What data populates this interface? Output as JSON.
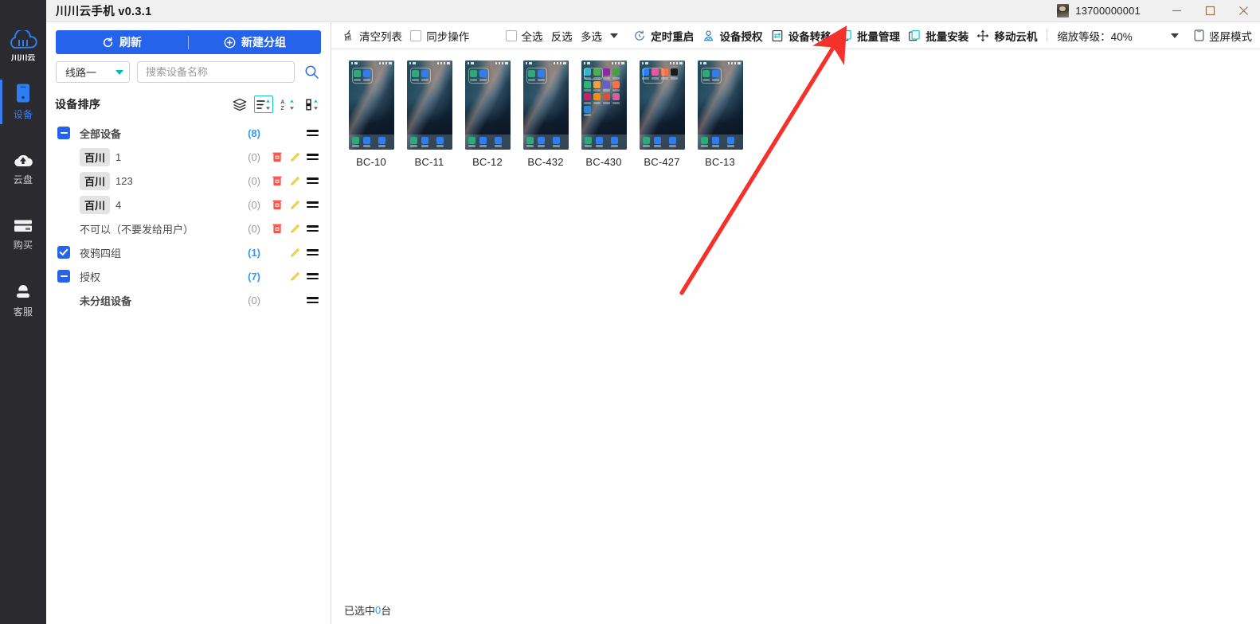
{
  "window": {
    "title": "川川云手机 v0.3.1",
    "account": "13700000001",
    "minimize_label": "—",
    "maximize_label": "□",
    "close_label": "✕"
  },
  "rail": {
    "logo_text": "川川云",
    "items": [
      {
        "label": "设备",
        "icon": "phone-icon",
        "active": true
      },
      {
        "label": "云盘",
        "icon": "cloud-upload-icon",
        "active": false
      },
      {
        "label": "购买",
        "icon": "credit-card-icon",
        "active": false
      },
      {
        "label": "客服",
        "icon": "headset-person-icon",
        "active": false
      }
    ]
  },
  "groups_panel": {
    "refresh_label": "刷新",
    "new_group_label": "新建分组",
    "line_select": "线路一",
    "search_placeholder": "搜索设备名称",
    "search_value": "",
    "sort_title": "设备排序",
    "sort_icons": [
      {
        "name": "layers-icon",
        "active": false
      },
      {
        "name": "list-sort-icon",
        "active": true
      },
      {
        "name": "alpha-sort-icon",
        "active": false
      },
      {
        "name": "column-sort-icon",
        "active": false
      }
    ],
    "rows": [
      {
        "check": "partial",
        "tag": "",
        "name": "全部设备",
        "count": "(8)",
        "count_hl": true,
        "bold": true,
        "indent": false,
        "delete": false,
        "edit": false
      },
      {
        "check": "none",
        "tag": "百川",
        "name": "1",
        "count": "(0)",
        "count_hl": false,
        "bold": false,
        "indent": true,
        "delete": true,
        "edit": true
      },
      {
        "check": "none",
        "tag": "百川",
        "name": "123",
        "count": "(0)",
        "count_hl": false,
        "bold": false,
        "indent": true,
        "delete": true,
        "edit": true
      },
      {
        "check": "none",
        "tag": "百川",
        "name": "4",
        "count": "(0)",
        "count_hl": false,
        "bold": false,
        "indent": true,
        "delete": true,
        "edit": true
      },
      {
        "check": "none",
        "tag": "",
        "name": "不可以（不要发给用户）",
        "count": "(0)",
        "count_hl": false,
        "bold": false,
        "indent": true,
        "delete": true,
        "edit": true
      },
      {
        "check": "checked",
        "tag": "",
        "name": "夜鸦四组",
        "count": "(1)",
        "count_hl": true,
        "bold": false,
        "indent": false,
        "delete": false,
        "edit": true
      },
      {
        "check": "partial",
        "tag": "",
        "name": "授权",
        "count": "(7)",
        "count_hl": true,
        "bold": false,
        "indent": false,
        "delete": false,
        "edit": true
      },
      {
        "check": "none",
        "tag": "",
        "name": "未分组设备",
        "count": "(0)",
        "count_hl": false,
        "bold": true,
        "indent": true,
        "delete": false,
        "edit": false
      }
    ]
  },
  "toolbar": {
    "clear_list": "清空列表",
    "sync_op": "同步操作",
    "select_all": "全选",
    "invert_select": "反选",
    "multi_select": "多选",
    "timed_restart": "定时重启",
    "device_auth": "设备授权",
    "device_transfer": "设备转移",
    "batch_manage": "批量管理",
    "batch_install": "批量安装",
    "move_cloud": "移动云机",
    "zoom_label": "缩放等级：40%",
    "portrait_mode": "竖屏模式"
  },
  "devices": [
    {
      "name": "BC-10",
      "layout": "sparse"
    },
    {
      "name": "BC-11",
      "layout": "sparse"
    },
    {
      "name": "BC-12",
      "layout": "sparse"
    },
    {
      "name": "BC-432",
      "layout": "sparse"
    },
    {
      "name": "BC-430",
      "layout": "full"
    },
    {
      "name": "BC-427",
      "layout": "row4"
    },
    {
      "name": "BC-13",
      "layout": "sparse"
    }
  ],
  "status": {
    "prefix": "已选中",
    "count": "0",
    "suffix": "台"
  },
  "annotation": {
    "arrow_color": "#f4312a",
    "points_to": "设备转移"
  },
  "colors": {
    "accent_blue": "#2563eb",
    "link_blue": "#2f9bf0",
    "teal": "#19c2c9",
    "rail_bg": "#2b2b2f",
    "delete_red": "#f5554a",
    "edit_yellow": "#f6d24a"
  }
}
